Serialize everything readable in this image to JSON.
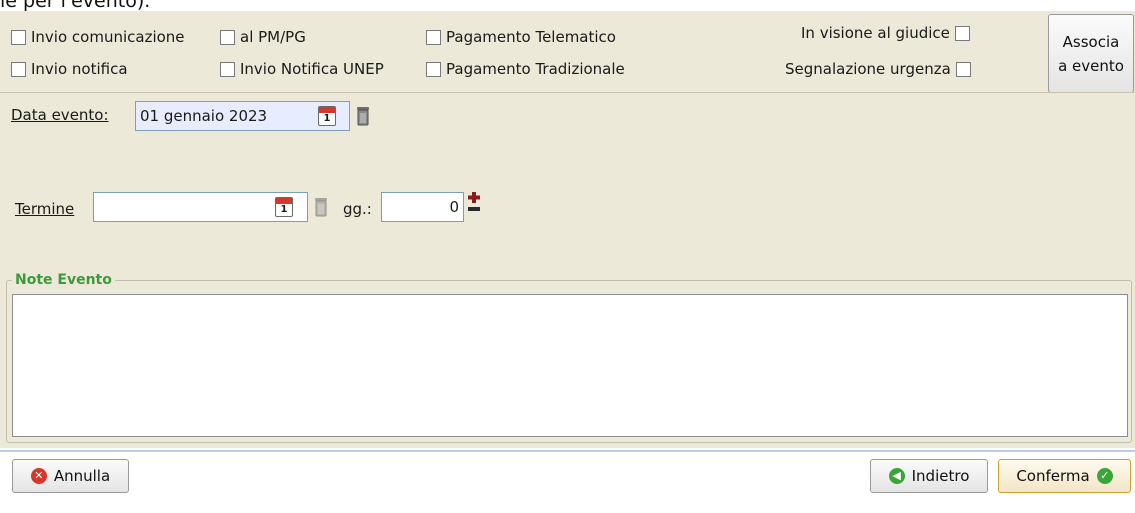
{
  "top_clipped_text": "le per l'evento).",
  "flags": {
    "invio_comunicazione": "Invio comunicazione",
    "al_pm_pg": "al PM/PG",
    "pagamento_telematico": "Pagamento Telematico",
    "in_visione_giudice": "In visione al giudice",
    "invio_notifica": "Invio notifica",
    "invio_notifica_unep": "Invio Notifica UNEP",
    "pagamento_tradizionale": "Pagamento Tradizionale",
    "segnalazione_urgenza": "Segnalazione urgenza"
  },
  "associa_button": {
    "line1": "Associa",
    "line2": "a evento"
  },
  "data_evento": {
    "label": "Data evento:",
    "value": "01 gennaio 2023",
    "calendar_day": "1"
  },
  "termine": {
    "label": "Termine",
    "value": "",
    "calendar_day": "1",
    "gg_label": "gg.:",
    "gg_value": "0"
  },
  "note_evento": {
    "legend": "Note Evento",
    "value": ""
  },
  "footer": {
    "annulla": "Annulla",
    "indietro": "Indietro",
    "conferma": "Conferma"
  },
  "colors": {
    "panel_bg": "#ece9d8",
    "legend_green": "#3c9a3c",
    "cancel_red": "#d9352a",
    "ok_green": "#3aa63a",
    "date_field_bg": "#e8ecff"
  },
  "icons": {
    "calendar": "calendar-icon",
    "trash": "trash-icon",
    "plus_minus": "plus-minus-icon",
    "cancel": "cancel-icon",
    "back": "back-arrow-icon",
    "confirm": "check-icon"
  }
}
